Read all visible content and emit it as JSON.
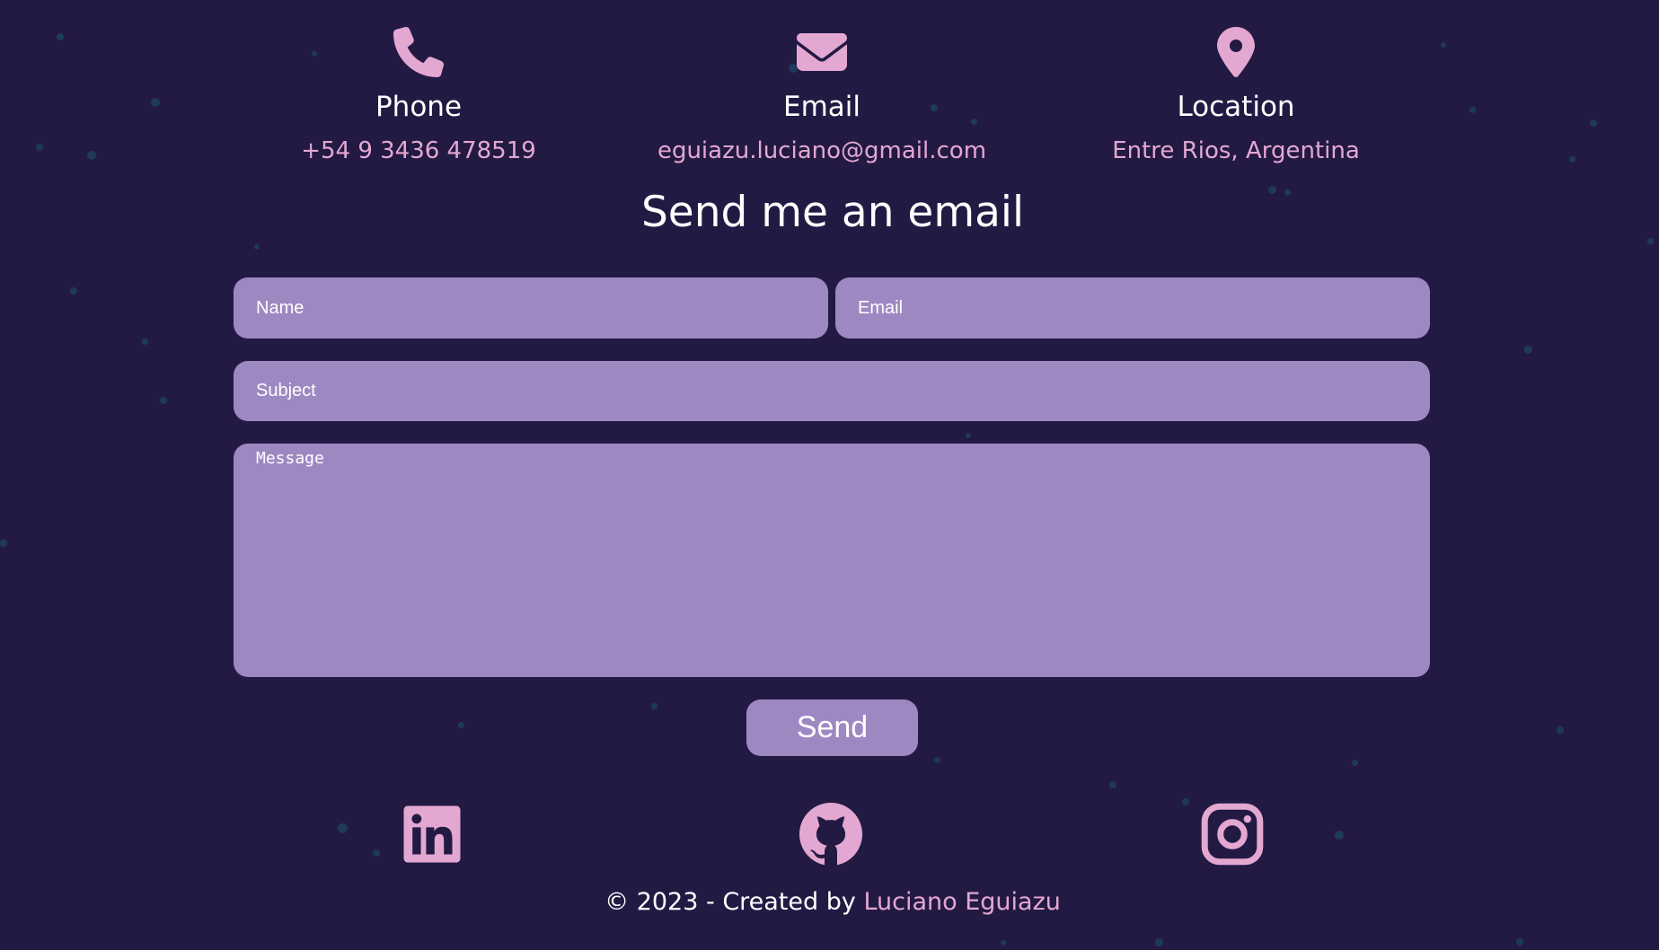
{
  "contact_info": [
    {
      "icon": "phone-icon",
      "title": "Phone",
      "value": "+54 9 3436 478519"
    },
    {
      "icon": "envelope-icon",
      "title": "Email",
      "value": "eguiazu.luciano@gmail.com"
    },
    {
      "icon": "map-pin-icon",
      "title": "Location",
      "value": "Entre Rios, Argentina"
    }
  ],
  "form": {
    "title": "Send me an email",
    "name_placeholder": "Name",
    "email_placeholder": "Email",
    "subject_placeholder": "Subject",
    "message_placeholder": "Message",
    "send_label": "Send"
  },
  "social": [
    {
      "icon": "linkedin-icon"
    },
    {
      "icon": "github-icon"
    },
    {
      "icon": "instagram-icon"
    }
  ],
  "footer": {
    "prefix": "© 2023 - Created by ",
    "author": "Luciano Eguiazu"
  },
  "colors": {
    "background": "#231A44",
    "accent": "#E3A8D1",
    "field": "#9E88C2",
    "text": "#FFFFFF"
  }
}
